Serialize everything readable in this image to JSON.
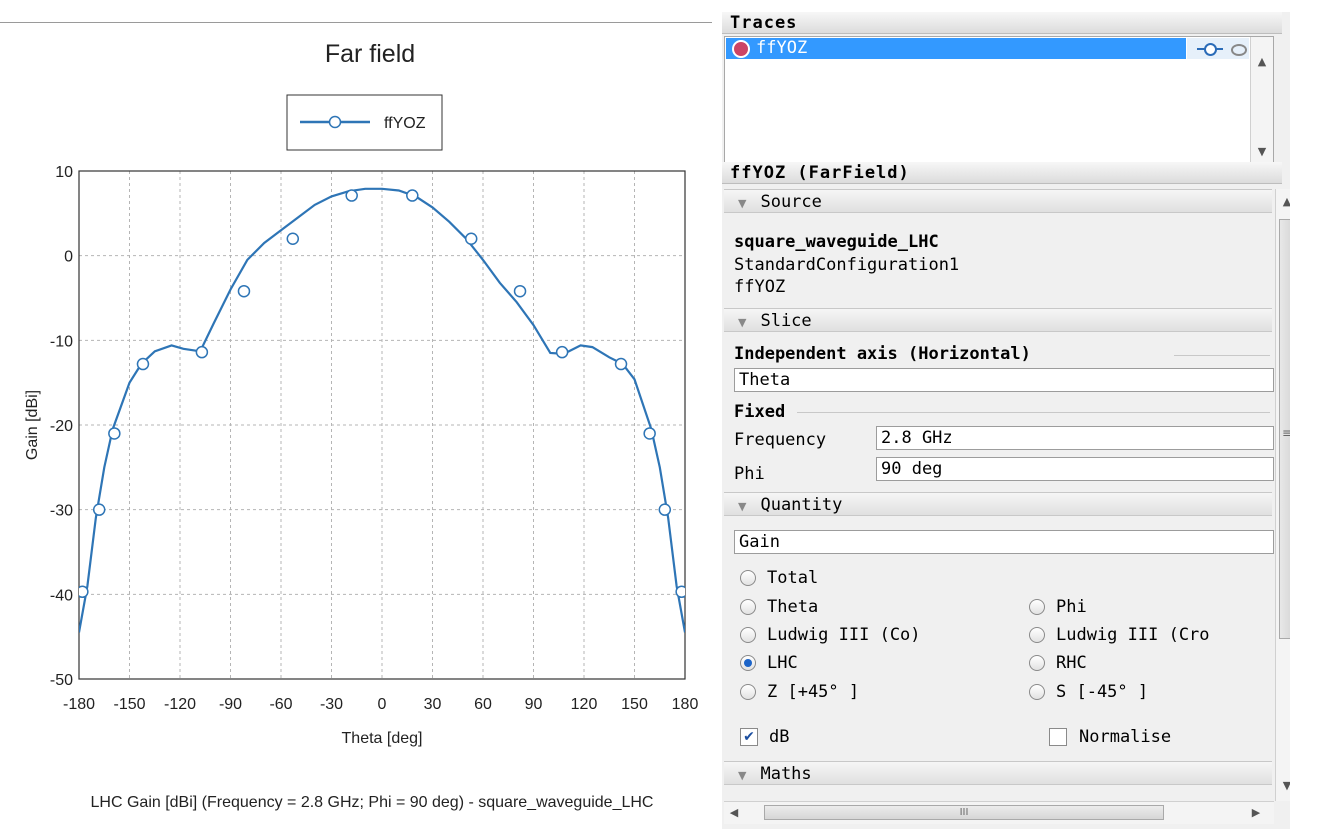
{
  "chart_data": {
    "type": "line",
    "title": "Far field",
    "xlabel": "Theta [deg]",
    "ylabel": "Gain [dBi]",
    "footer": "LHC Gain [dBi] (Frequency = 2.8 GHz; Phi = 90 deg) - square_waveguide_LHC",
    "xlim": [
      -180,
      180
    ],
    "ylim": [
      -50,
      10
    ],
    "x_ticks": [
      "-180",
      "-150",
      "-120",
      "-90",
      "-60",
      "-30",
      "0",
      "30",
      "60",
      "90",
      "120",
      "150",
      "180"
    ],
    "y_ticks": [
      "10",
      "0",
      "-10",
      "-20",
      "-30",
      "-40",
      "-50"
    ],
    "grid": true,
    "legend": "top-center",
    "color": "#2e75b6",
    "series": [
      {
        "name": "ffYOZ",
        "x": [
          -180,
          -175,
          -170,
          -165,
          -160,
          -150,
          -143,
          -135,
          -125,
          -118,
          -108,
          -100,
          -90,
          -80,
          -70,
          -60,
          -50,
          -40,
          -30,
          -20,
          -10,
          0,
          10,
          20,
          30,
          40,
          50,
          60,
          70,
          80,
          90,
          100,
          108,
          118,
          125,
          135,
          143,
          150,
          160,
          165,
          170,
          175,
          180
        ],
        "y": [
          -44.5,
          -39,
          -31,
          -25,
          -20.5,
          -15,
          -12.8,
          -11.3,
          -10.6,
          -11,
          -11.3,
          -8,
          -4,
          -0.5,
          1.5,
          3,
          4.5,
          6,
          7,
          7.6,
          7.9,
          7.9,
          7.7,
          7,
          5.7,
          4,
          2,
          -0.5,
          -3.2,
          -5.5,
          -8.2,
          -11.5,
          -11.6,
          -10.6,
          -10.8,
          -12,
          -12.8,
          -14.6,
          -20.5,
          -25,
          -31,
          -39,
          -44.5
        ]
      }
    ],
    "markers": {
      "x": [
        -178,
        -168,
        -159,
        -142,
        -107,
        -82,
        -53,
        -18,
        18,
        53,
        82,
        107,
        142,
        159,
        168,
        178
      ],
      "y": [
        -39.7,
        -30,
        -21,
        -12.8,
        -11.4,
        -4.2,
        2,
        7.1,
        7.1,
        2,
        -4.2,
        -11.4,
        -12.8,
        -21,
        -30,
        -39.7
      ]
    }
  },
  "traces": {
    "header": "Traces",
    "items": [
      {
        "name": "ffYOZ"
      }
    ]
  },
  "props": {
    "header": "ffYOZ (FarField)",
    "source": {
      "label": "Source",
      "lines": [
        "square_waveguide_LHC",
        "StandardConfiguration1",
        "ffYOZ"
      ]
    },
    "slice": {
      "label": "Slice",
      "independent_label": "Independent axis (Horizontal)",
      "independent_value": "Theta",
      "fixed_label": "Fixed",
      "frequency_label": "Frequency",
      "frequency_value": "2.8 GHz",
      "phi_label": "Phi",
      "phi_value": "90 deg"
    },
    "quantity": {
      "label": "Quantity",
      "value": "Gain",
      "options": [
        "Total",
        "Theta",
        "Phi",
        "Ludwig III (Co)",
        "Ludwig III (Cro",
        "LHC",
        "RHC",
        "Z [+45° ]",
        "S [-45° ]"
      ],
      "selected": "LHC",
      "db_label": "dB",
      "db_checked": true,
      "normalise_label": "Normalise",
      "normalise_checked": false
    },
    "maths": {
      "label": "Maths"
    },
    "scroll_grip": "≡",
    "hscroll_grip": "III"
  }
}
